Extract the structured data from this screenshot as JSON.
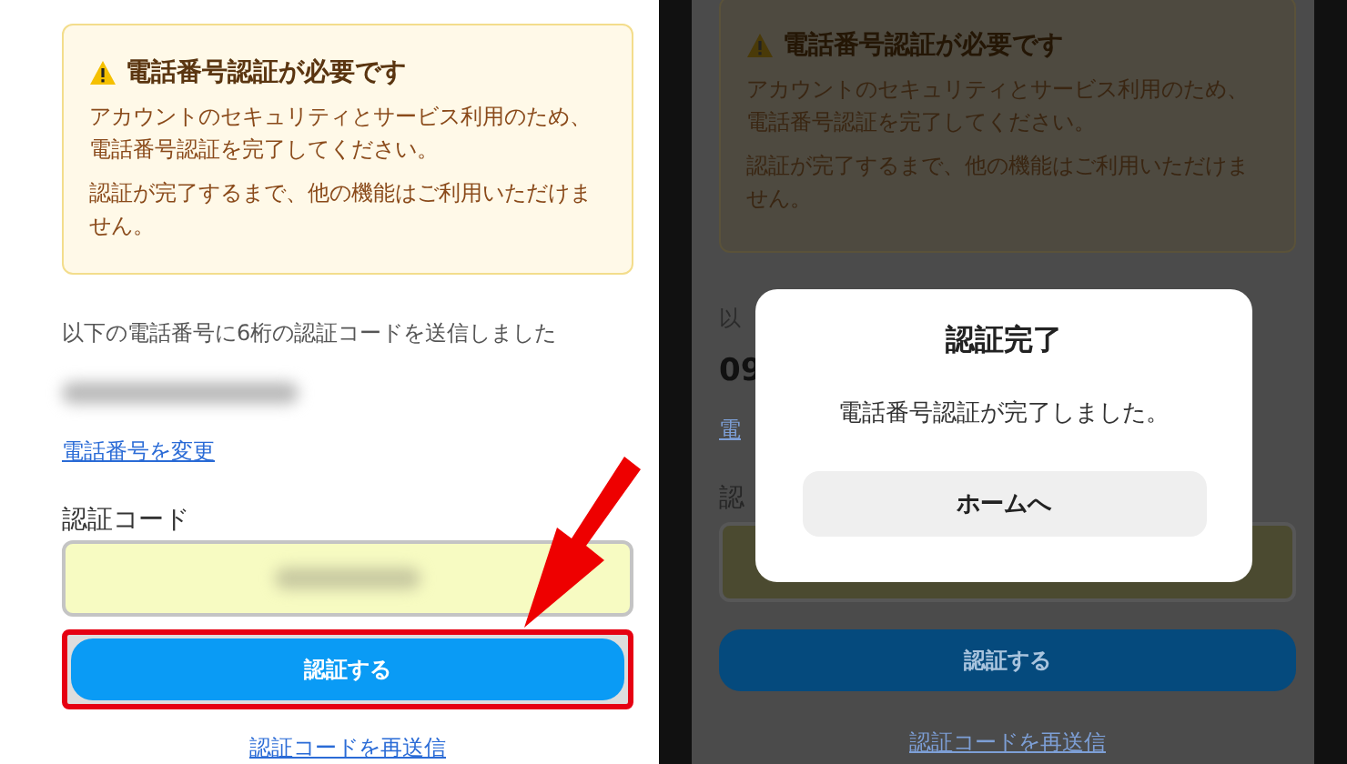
{
  "screens": [
    {
      "dimmed": false,
      "warning": {
        "title": "電話番号認証が必要です",
        "paragraphs": [
          "アカウントのセキュリティとサービス利用のため、電話番号認証を完了してください。",
          "認証が完了するまで、他の機能はご利用いただけません。"
        ]
      },
      "sent_text": "以下の電話番号に6桁の認証コードを送信しました",
      "phone_blurred": true,
      "change_link": "電話番号を変更",
      "code_label": "認証コード",
      "code_blurred": true,
      "submit": {
        "label": "認証する",
        "highlighted": true
      },
      "resend_link": "認証コードを再送信",
      "arrow": true
    },
    {
      "dimmed": true,
      "warning": {
        "title": "電話番号認証が必要です",
        "paragraphs": [
          "アカウントのセキュリティとサービス利用のため、電話番号認証を完了してください。",
          "認証が完了するまで、他の機能はご利用いただけません。"
        ]
      },
      "sent_text": "以",
      "phone_number": "09",
      "change_link": "電",
      "code_label": "認",
      "submit": {
        "label": "認証する",
        "highlighted": false
      },
      "resend_link": "認証コードを再送信",
      "dialog": {
        "title": "認証完了",
        "message": "電話番号認証が完了しました。",
        "button": "ホームへ"
      }
    }
  ]
}
